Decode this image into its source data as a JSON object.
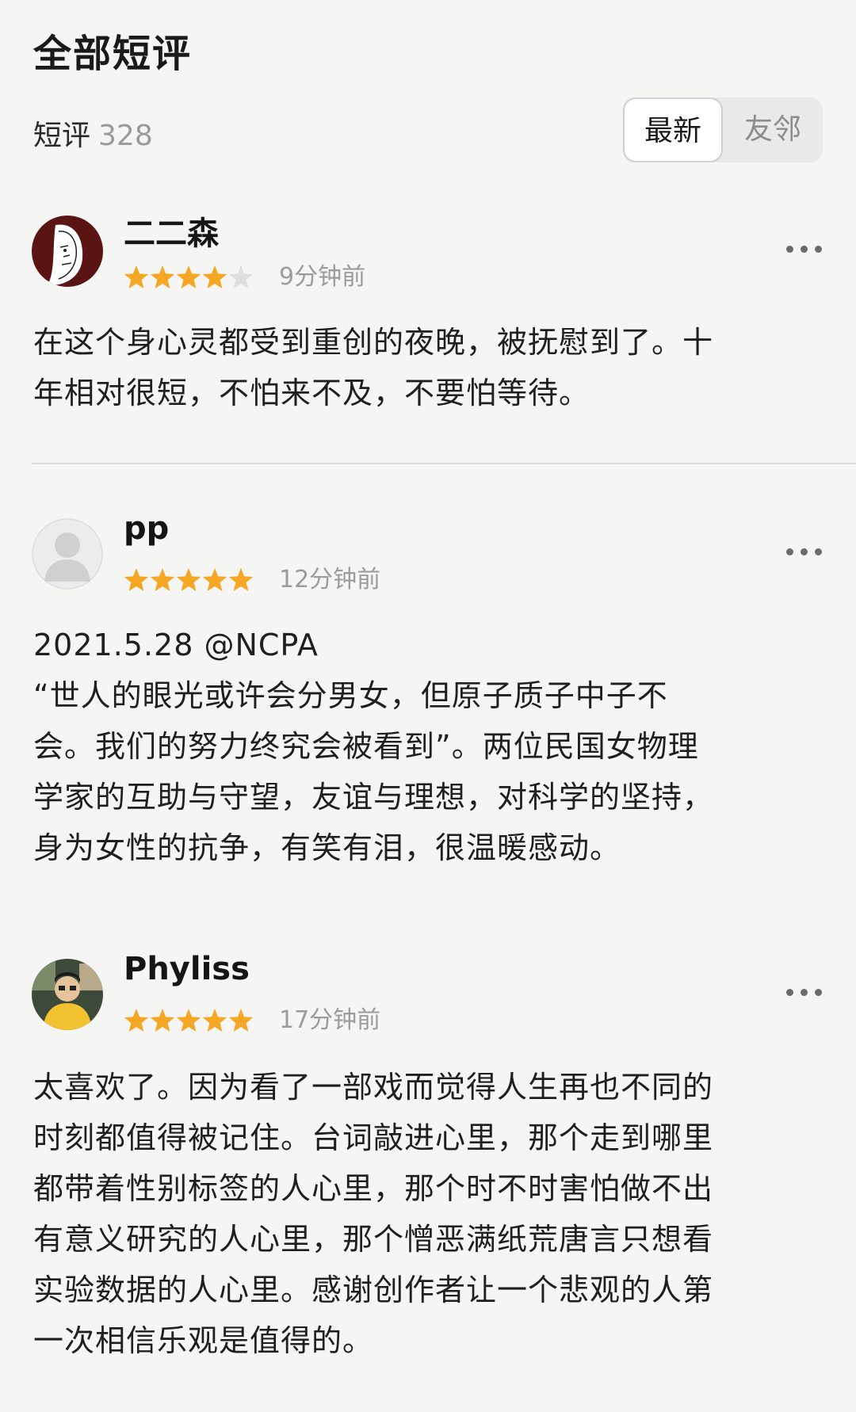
{
  "header": {
    "title": "全部短评",
    "count_label": "短评",
    "count_value": "328",
    "sort_options": [
      "最新",
      "友邻"
    ],
    "active_sort": "最新"
  },
  "colors": {
    "star_filled": "#f5a623",
    "star_empty": "#dedede",
    "background": "#f5f5f3"
  },
  "reviews": [
    {
      "username": "二二森",
      "rating": 4,
      "max_rating": 5,
      "time": "9分钟前",
      "text": "在这个身心灵都受到重创的夜晚，被抚慰到了。十\n年相对很短，不怕来不及，不要怕等待。"
    },
    {
      "username": "pp",
      "rating": 5,
      "max_rating": 5,
      "time": "12分钟前",
      "text": "2021.5.28 @NCPA\n“世人的眼光或许会分男女，但原子质子中子不\n会。我们的努力终究会被看到”。两位民国女物理\n学家的互助与守望，友谊与理想，对科学的坚持，\n身为女性的抗争，有笑有泪，很温暖感动。"
    },
    {
      "username": "Phyliss",
      "rating": 5,
      "max_rating": 5,
      "time": "17分钟前",
      "text": "太喜欢了。因为看了一部戏而觉得人生再也不同的\n时刻都值得被记住。台词敲进心里，那个走到哪里\n都带着性别标签的人心里，那个时不时害怕做不出\n有意义研究的人心里，那个憎恶满纸荒唐言只想看\n实验数据的人心里。感谢创作者让一个悲观的人第\n一次相信乐观是值得的。"
    }
  ]
}
